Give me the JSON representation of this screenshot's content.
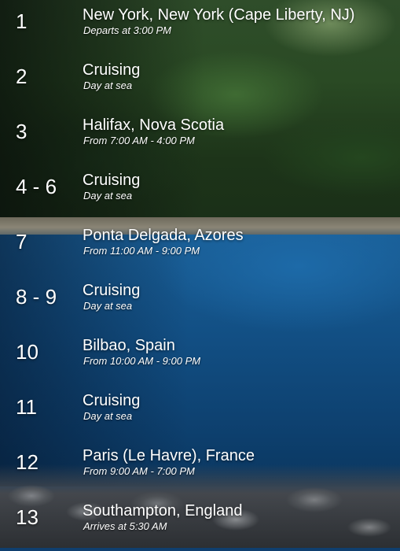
{
  "itinerary": {
    "stops": [
      {
        "day": "1",
        "port": "New York, New York (Cape Liberty, NJ)",
        "time": "Departs at 3:00 PM"
      },
      {
        "day": "2",
        "port": "Cruising",
        "time": "Day at sea"
      },
      {
        "day": "3",
        "port": "Halifax, Nova Scotia",
        "time": "From 7:00 AM - 4:00 PM"
      },
      {
        "day": "4 - 6",
        "port": "Cruising",
        "time": "Day at sea"
      },
      {
        "day": "7",
        "port": "Ponta Delgada, Azores",
        "time": "From 11:00 AM - 9:00 PM"
      },
      {
        "day": "8 - 9",
        "port": "Cruising",
        "time": "Day at sea"
      },
      {
        "day": "10",
        "port": "Bilbao, Spain",
        "time": "From 10:00 AM - 9:00 PM"
      },
      {
        "day": "11",
        "port": "Cruising",
        "time": "Day at sea"
      },
      {
        "day": "12",
        "port": "Paris (Le Havre), France",
        "time": "From 9:00 AM - 7:00 PM"
      },
      {
        "day": "13",
        "port": "Southampton, England",
        "time": "Arrives at 5:30 AM"
      }
    ]
  }
}
